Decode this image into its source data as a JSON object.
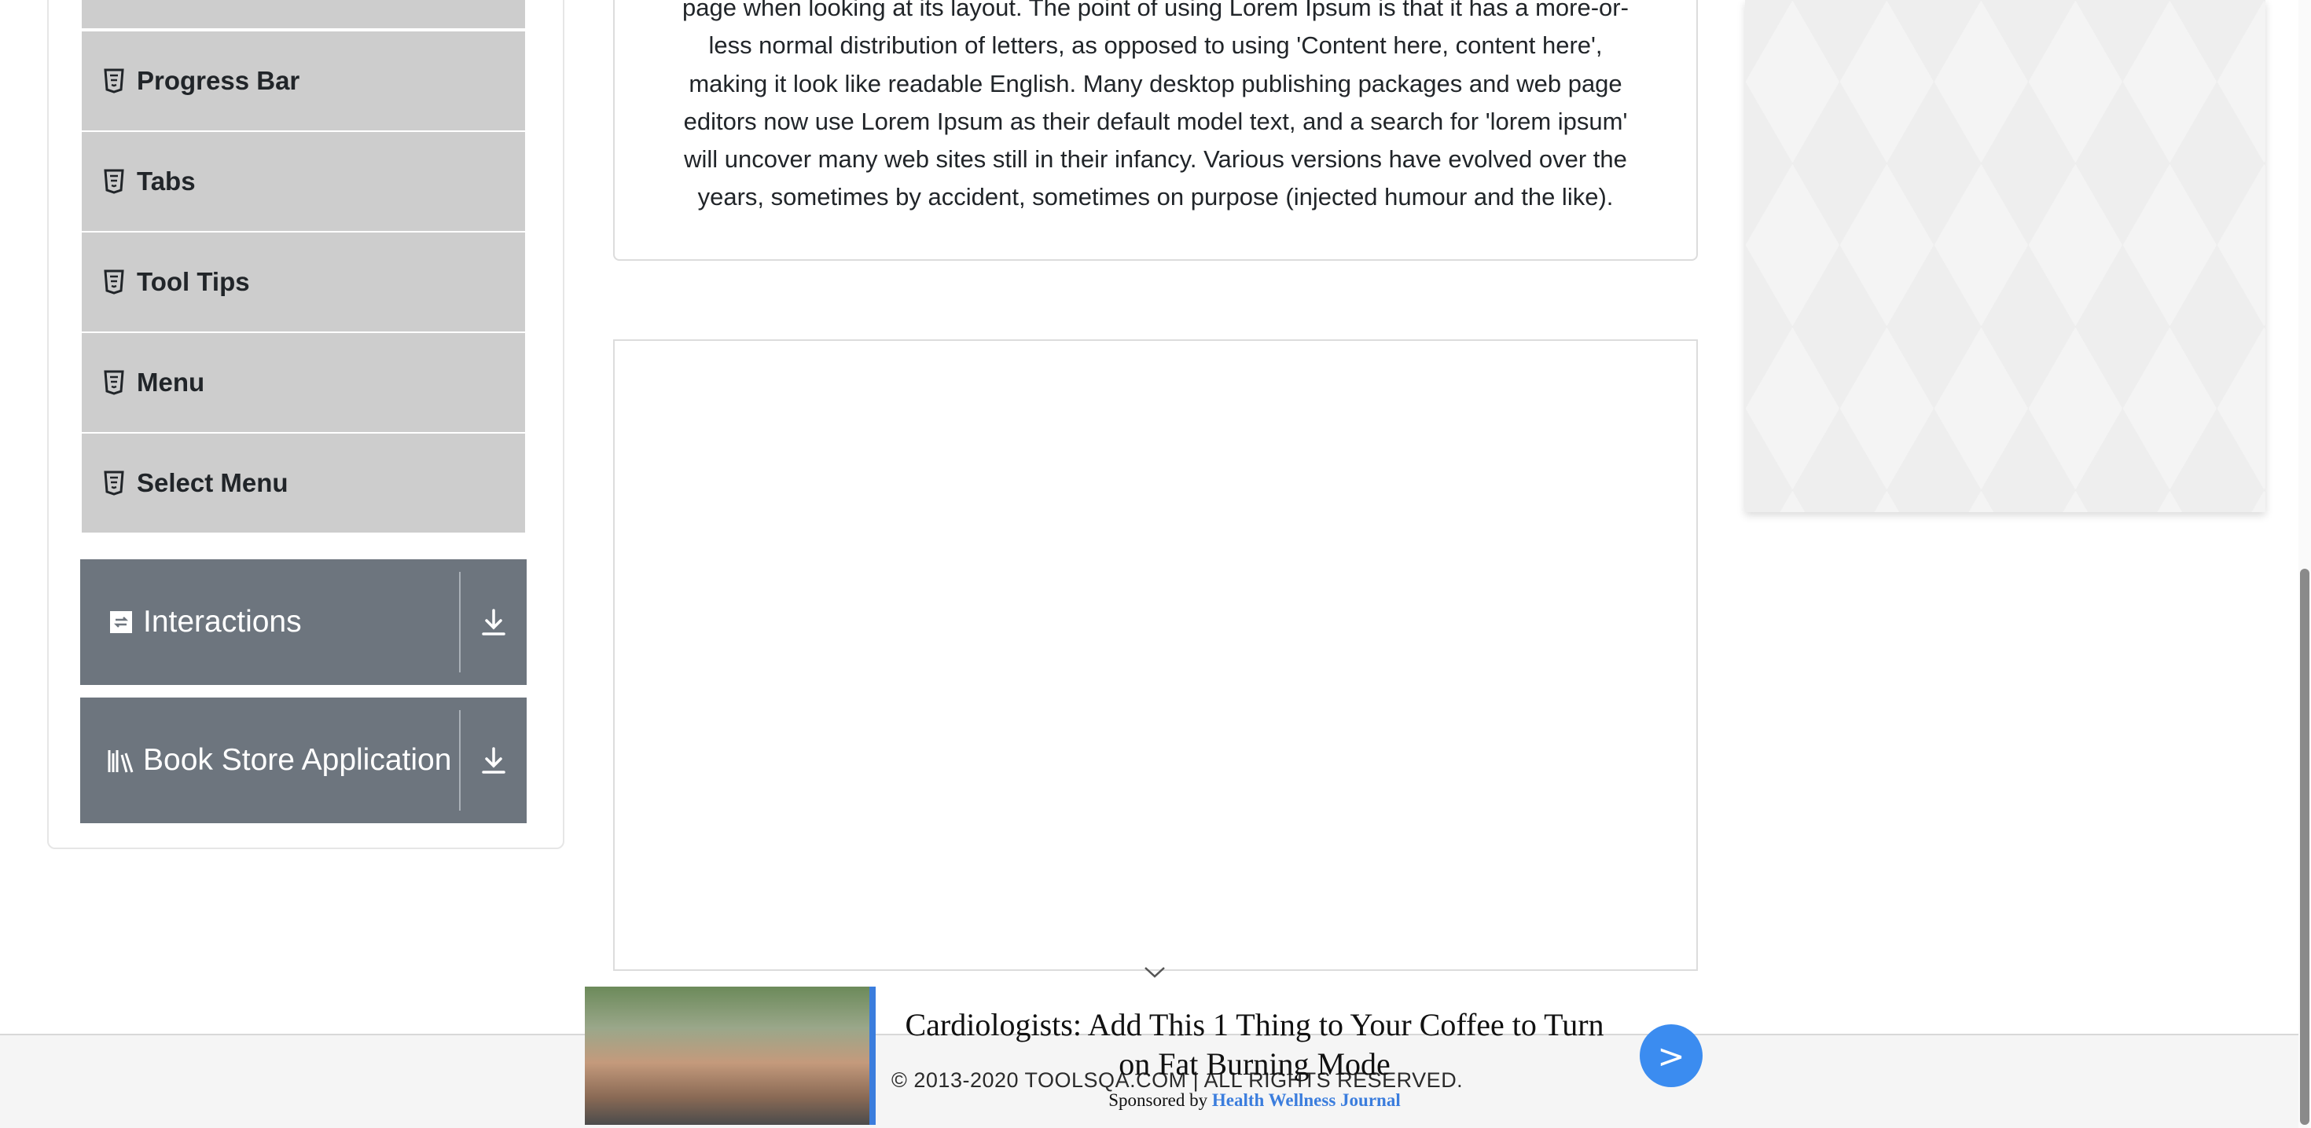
{
  "sidebar": {
    "items": [
      {
        "label": "",
        "icon": "html5-icon"
      },
      {
        "label": "Progress Bar",
        "icon": "html5-icon"
      },
      {
        "label": "Tabs",
        "icon": "html5-icon"
      },
      {
        "label": "Tool Tips",
        "icon": "html5-icon"
      },
      {
        "label": "Menu",
        "icon": "html5-icon"
      },
      {
        "label": "Select Menu",
        "icon": "html5-icon"
      }
    ],
    "groups": [
      {
        "label": "Interactions",
        "icon": "interactions-icon",
        "action_icon": "download-icon"
      },
      {
        "label": "Book Store Application",
        "icon": "books-icon",
        "action_icon": "download-icon"
      }
    ]
  },
  "main": {
    "lorem_lines": [
      "page when looking at its layout. The point of using Lorem Ipsum is that it has a more-or-",
      "less normal distribution of letters, as opposed to using 'Content here, content here',",
      "making it look like readable English. Many desktop publishing packages and web page",
      "editors now use Lorem Ipsum as their default model text, and a search for 'lorem ipsum'",
      "will uncover many web sites still in their infancy. Various versions have evolved over the",
      "years, sometimes by accident, sometimes on purpose (injected humour and the like)."
    ]
  },
  "footer": {
    "copyright": "© 2013-2020 TOOLSQA.COM | ALL RIGHTS RESERVED."
  },
  "ad": {
    "headline": "Cardiologists: Add This 1 Thing to Your Coffee to Turn on Fat Burning Mode",
    "sponsor_prefix": "Sponsored by",
    "sponsor_name": "Health Wellness Journal",
    "next_label": ">",
    "collapse_icon": "chevron-down-icon"
  },
  "colors": {
    "menu_item_bg": "#cdcdcd",
    "group_header_bg": "#6d757e",
    "ad_accent": "#3b8cf0"
  }
}
